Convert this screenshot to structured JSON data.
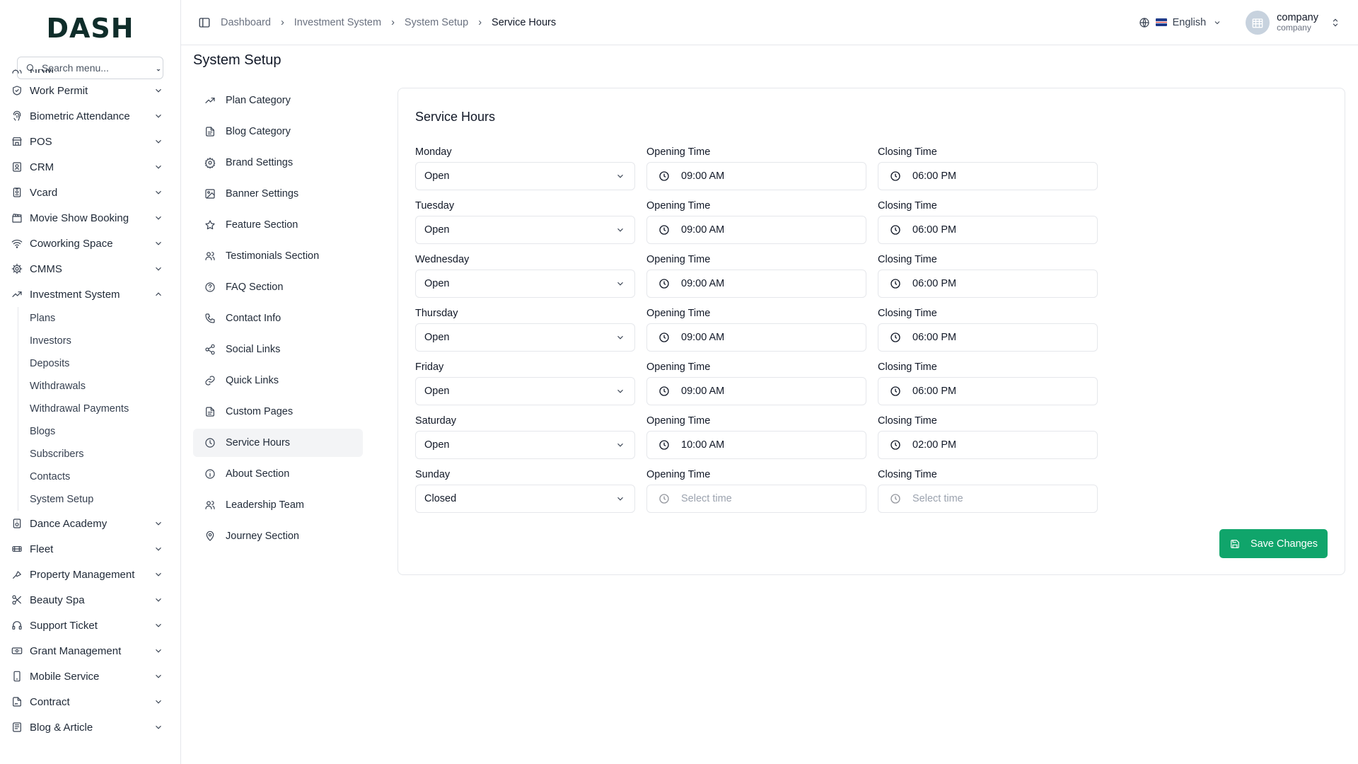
{
  "brand": {
    "logo_text": "DASH"
  },
  "sidebar": {
    "search_placeholder": "Search menu...",
    "partial_item": "HRM",
    "items_top": [
      {
        "label": "Work Permit",
        "icon": "shield-check-icon"
      },
      {
        "label": "Biometric Attendance",
        "icon": "fingerprint-icon"
      },
      {
        "label": "POS",
        "icon": "store-icon"
      },
      {
        "label": "CRM",
        "icon": "contact-icon"
      },
      {
        "label": "Vcard",
        "icon": "badge-icon"
      },
      {
        "label": "Movie Show Booking",
        "icon": "clapperboard-icon"
      },
      {
        "label": "Coworking Space",
        "icon": "wifi-icon"
      },
      {
        "label": "CMMS",
        "icon": "cog-icon"
      }
    ],
    "expanded": {
      "label": "Investment System",
      "icon": "trending-up-icon",
      "children": [
        "Plans",
        "Investors",
        "Deposits",
        "Withdrawals",
        "Withdrawal Payments",
        "Blogs",
        "Subscribers",
        "Contacts",
        "System Setup"
      ]
    },
    "items_bottom": [
      {
        "label": "Dance Academy",
        "icon": "music-icon"
      },
      {
        "label": "Fleet",
        "icon": "car-icon"
      },
      {
        "label": "Property Management",
        "icon": "building-icon"
      },
      {
        "label": "Beauty Spa",
        "icon": "scissors-icon"
      },
      {
        "label": "Support Ticket",
        "icon": "headphones-icon"
      },
      {
        "label": "Grant Management",
        "icon": "banknote-icon"
      },
      {
        "label": "Mobile Service",
        "icon": "smartphone-icon"
      },
      {
        "label": "Contract",
        "icon": "file-signature-icon"
      },
      {
        "label": "Blog & Article",
        "icon": "newspaper-icon"
      }
    ]
  },
  "header": {
    "breadcrumb": [
      "Dashboard",
      "Investment System",
      "System Setup",
      "Service Hours"
    ],
    "language": "English",
    "user_name": "company",
    "user_role": "company"
  },
  "page": {
    "title": "System Setup",
    "subnav": [
      {
        "label": "Plan Category",
        "icon": "trending-up-icon"
      },
      {
        "label": "Blog Category",
        "icon": "file-text-icon"
      },
      {
        "label": "Brand Settings",
        "icon": "settings-icon"
      },
      {
        "label": "Banner Settings",
        "icon": "image-icon"
      },
      {
        "label": "Feature Section",
        "icon": "star-icon"
      },
      {
        "label": "Testimonials Section",
        "icon": "users-icon"
      },
      {
        "label": "FAQ Section",
        "icon": "help-circle-icon"
      },
      {
        "label": "Contact Info",
        "icon": "phone-icon"
      },
      {
        "label": "Social Links",
        "icon": "share-icon"
      },
      {
        "label": "Quick Links",
        "icon": "link-icon"
      },
      {
        "label": "Custom Pages",
        "icon": "file-text-icon"
      },
      {
        "label": "Service Hours",
        "icon": "clock-icon",
        "active": true
      },
      {
        "label": "About Section",
        "icon": "info-icon"
      },
      {
        "label": "Leadership Team",
        "icon": "users-icon"
      },
      {
        "label": "Journey Section",
        "icon": "map-pin-icon"
      }
    ]
  },
  "service_hours": {
    "title": "Service Hours",
    "opening_label": "Opening Time",
    "closing_label": "Closing Time",
    "time_placeholder": "Select time",
    "days": [
      {
        "day": "Monday",
        "status": "Open",
        "opening": "09:00 AM",
        "closing": "06:00 PM"
      },
      {
        "day": "Tuesday",
        "status": "Open",
        "opening": "09:00 AM",
        "closing": "06:00 PM"
      },
      {
        "day": "Wednesday",
        "status": "Open",
        "opening": "09:00 AM",
        "closing": "06:00 PM"
      },
      {
        "day": "Thursday",
        "status": "Open",
        "opening": "09:00 AM",
        "closing": "06:00 PM"
      },
      {
        "day": "Friday",
        "status": "Open",
        "opening": "09:00 AM",
        "closing": "06:00 PM"
      },
      {
        "day": "Saturday",
        "status": "Open",
        "opening": "10:00 AM",
        "closing": "02:00 PM"
      },
      {
        "day": "Sunday",
        "status": "Closed",
        "opening": "",
        "closing": ""
      }
    ],
    "save_label": "Save Changes"
  },
  "colors": {
    "accent": "#10a56b",
    "active_bg": "#f3f4f6",
    "border": "#e5e7eb"
  }
}
